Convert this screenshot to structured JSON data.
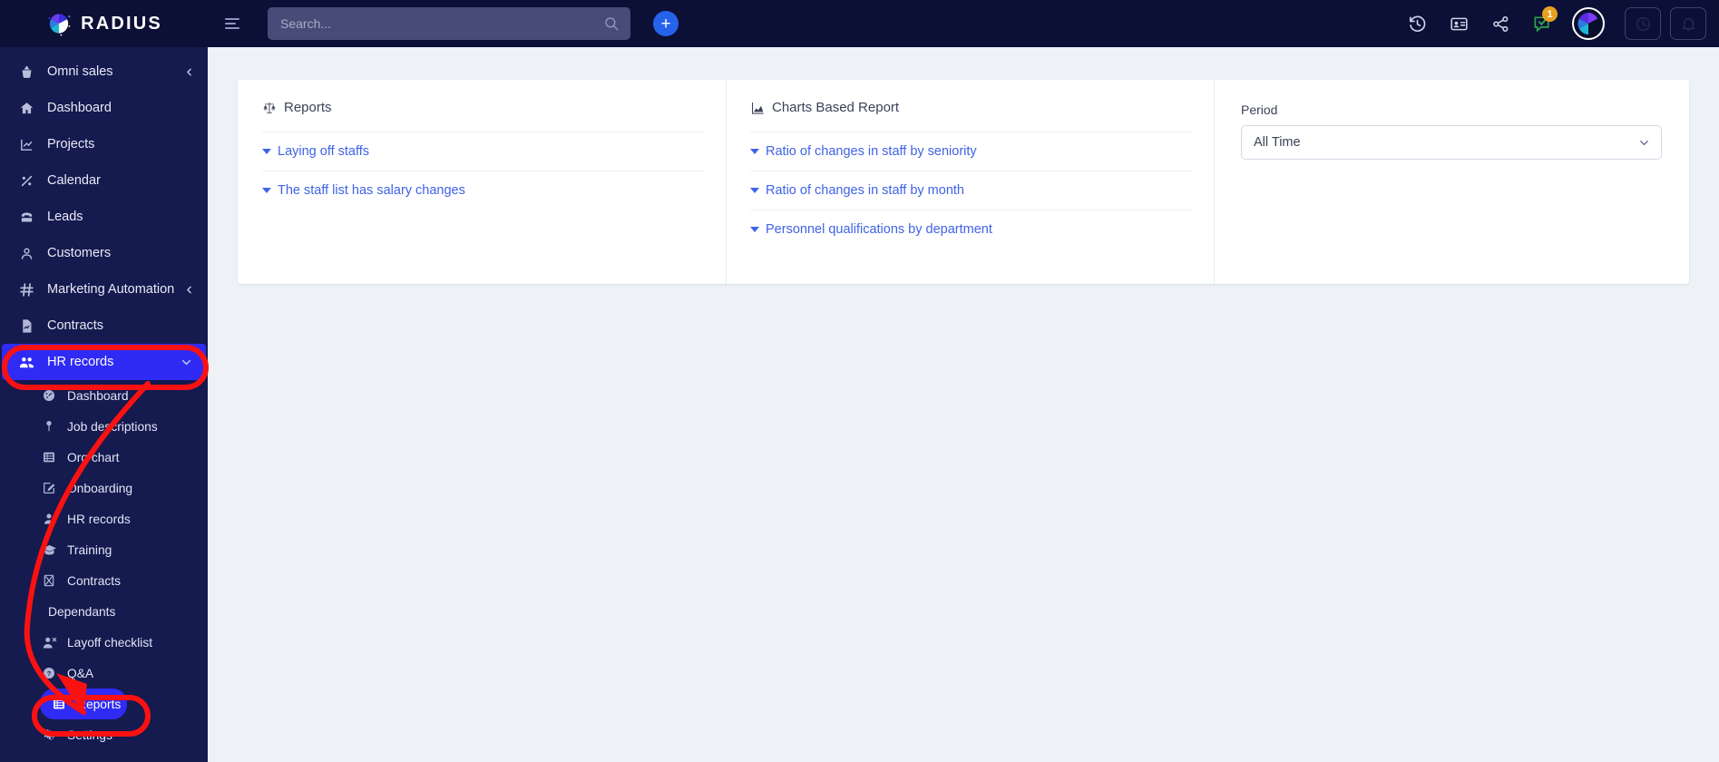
{
  "brand": {
    "name": "RADIUS"
  },
  "topbar": {
    "menu_icon": "hamburger-icon",
    "search": {
      "placeholder": "Search...",
      "value": ""
    },
    "add_label": "+",
    "icons": [
      {
        "name": "history-icon"
      },
      {
        "name": "contact-card-icon"
      },
      {
        "name": "share-icon"
      },
      {
        "name": "chat-icon",
        "badge": "1"
      }
    ],
    "avatar": "user-avatar",
    "right_buttons": [
      {
        "name": "clock-icon"
      },
      {
        "name": "bell-icon"
      }
    ]
  },
  "sidebar": {
    "items": [
      {
        "label": "Omni sales",
        "icon": "basket-icon",
        "chevron": "left"
      },
      {
        "label": "Dashboard",
        "icon": "home-icon"
      },
      {
        "label": "Projects",
        "icon": "chart-icon"
      },
      {
        "label": "Calendar",
        "icon": "percent-icon"
      },
      {
        "label": "Leads",
        "icon": "phone-icon"
      },
      {
        "label": "Customers",
        "icon": "person-icon"
      },
      {
        "label": "Marketing Automation",
        "icon": "hash-icon",
        "chevron": "left"
      },
      {
        "label": "Contracts",
        "icon": "document-icon"
      },
      {
        "label": "HR records",
        "icon": "people-icon",
        "chevron": "down",
        "active": true
      }
    ],
    "sub_items": [
      {
        "label": "Dashboard",
        "icon": "gauge-icon"
      },
      {
        "label": "Job descriptions",
        "icon": "pin-icon"
      },
      {
        "label": "Org chart",
        "icon": "list-icon"
      },
      {
        "label": "Onboarding",
        "icon": "edit-icon"
      },
      {
        "label": "HR records",
        "icon": "person-icon"
      },
      {
        "label": "Training",
        "icon": "graduation-cap-icon"
      },
      {
        "label": "Contracts",
        "icon": "boxed-x-icon"
      },
      {
        "label": "Dependants",
        "icon": "none"
      },
      {
        "label": "Layoff checklist",
        "icon": "person-remove-icon"
      },
      {
        "label": "Q&A",
        "icon": "question-icon"
      },
      {
        "label": "Reports",
        "icon": "list-report-icon",
        "highlight": true
      },
      {
        "label": "Settings",
        "icon": "gears-icon"
      }
    ]
  },
  "main": {
    "reports_column": {
      "title": "Reports",
      "icon": "scales-icon",
      "links": [
        "Laying off staffs",
        "The staff list has salary changes"
      ]
    },
    "charts_column": {
      "title": "Charts Based Report",
      "icon": "area-chart-icon",
      "links": [
        "Ratio of changes in staff by seniority",
        "Ratio of changes in staff by month",
        "Personnel qualifications by department"
      ]
    },
    "period_column": {
      "label": "Period",
      "value": "All Time"
    }
  },
  "annotations": {
    "highlight_color": "#fa1111",
    "targets": [
      "HR records",
      "Reports"
    ]
  }
}
